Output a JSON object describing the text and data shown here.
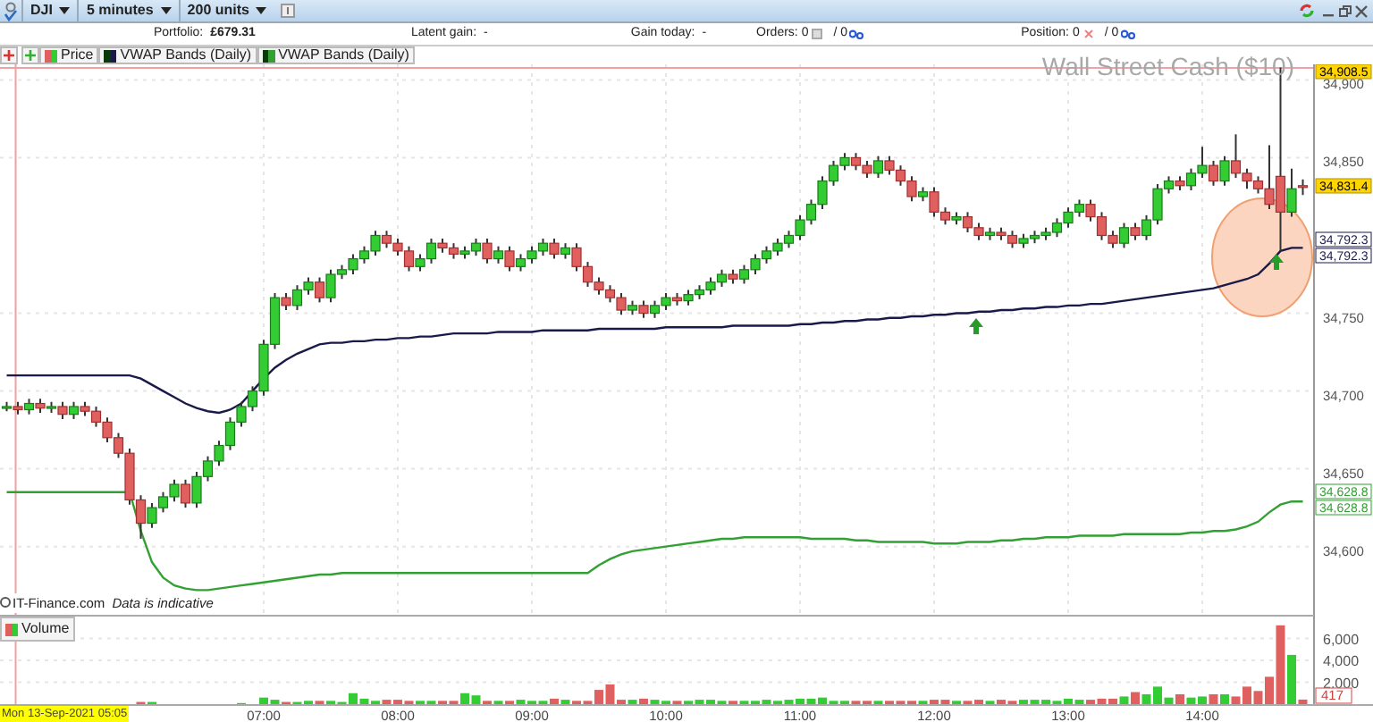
{
  "toolbar": {
    "selectors": [
      {
        "label": "DJI"
      },
      {
        "label": "5 minutes"
      },
      {
        "label": "200 units"
      }
    ]
  },
  "info_bar": {
    "portfolio_label": "Portfolio:",
    "portfolio_value": "£679.31",
    "latent_gain_label": "Latent gain:",
    "latent_gain_value": "-",
    "gain_today_label": "Gain today:",
    "gain_today_value": "-",
    "orders_label": "Orders:",
    "orders_value": "0",
    "orders_active": "/ 0",
    "position_label": "Position:",
    "position_value": "0",
    "position_active": "/ 0"
  },
  "price_legend": {
    "label": "Price"
  },
  "instrument_title": "Wall Street Cash ($10)",
  "source_note": {
    "source": "IT-Finance.com",
    "note": "Data is indicative"
  },
  "price_chart": {
    "chart_data": {
      "type": "candlestick",
      "grid": true,
      "ylim": [
        34555,
        34910
      ],
      "xlim": [
        302,
        916.4
      ],
      "ref_lines": [
        {
          "axis": "x",
          "value": 309,
          "color": "#f0a0a0"
        }
      ],
      "xticks": [
        {
          "value": 420,
          "label": "07:00"
        },
        {
          "value": 480,
          "label": "08:00"
        },
        {
          "value": 540,
          "label": "09:00"
        },
        {
          "value": 600,
          "label": "10:00"
        },
        {
          "value": 660,
          "label": "11:00"
        },
        {
          "value": 720,
          "label": "12:00"
        },
        {
          "value": 780,
          "label": "13:00"
        },
        {
          "value": 840,
          "label": "14:00"
        }
      ],
      "yticks": [
        {
          "value": 34600,
          "label": "34,600"
        },
        {
          "value": 34650,
          "label": "34,650"
        },
        {
          "value": 34700,
          "label": "34,700"
        },
        {
          "value": 34750,
          "label": "34,750"
        },
        {
          "value": 34850,
          "label": "34,850"
        },
        {
          "value": 34900,
          "label": "34,900"
        }
      ],
      "x": [
        305,
        310,
        315,
        320,
        325,
        330,
        335,
        340,
        345,
        350,
        355,
        360,
        365,
        370,
        375,
        380,
        385,
        390,
        395,
        400,
        405,
        410,
        415,
        420,
        425,
        430,
        435,
        440,
        445,
        450,
        455,
        460,
        465,
        470,
        475,
        480,
        485,
        490,
        495,
        500,
        505,
        510,
        515,
        520,
        525,
        530,
        535,
        540,
        545,
        550,
        555,
        560,
        565,
        570,
        575,
        580,
        585,
        590,
        595,
        600,
        605,
        610,
        615,
        620,
        625,
        630,
        635,
        640,
        645,
        650,
        655,
        660,
        665,
        670,
        675,
        680,
        685,
        690,
        695,
        700,
        705,
        710,
        715,
        720,
        725,
        730,
        735,
        740,
        745,
        750,
        755,
        760,
        765,
        770,
        775,
        780,
        785,
        790,
        795,
        800,
        805,
        810,
        815,
        820,
        825,
        830,
        835,
        840,
        845,
        850,
        855,
        860,
        865,
        870,
        875,
        880,
        885
      ],
      "ohlc": [
        [
          34690,
          34693,
          34687,
          34690
        ],
        [
          34690,
          34693,
          34685,
          34688
        ],
        [
          34688,
          34695,
          34685,
          34692
        ],
        [
          34692,
          34695,
          34686,
          34689
        ],
        [
          34689,
          34693,
          34686,
          34690
        ],
        [
          34690,
          34693,
          34682,
          34685
        ],
        [
          34685,
          34693,
          34682,
          34690
        ],
        [
          34690,
          34693,
          34684,
          34687
        ],
        [
          34687,
          34690,
          34677,
          34680
        ],
        [
          34680,
          34683,
          34667,
          34670
        ],
        [
          34670,
          34673,
          34657,
          34660
        ],
        [
          34660,
          34663,
          34627,
          34630
        ],
        [
          34630,
          34633,
          34605,
          34615
        ],
        [
          34615,
          34628,
          34612,
          34625
        ],
        [
          34625,
          34635,
          34622,
          34632
        ],
        [
          34632,
          34643,
          34629,
          34640
        ],
        [
          34640,
          34643,
          34625,
          34628
        ],
        [
          34628,
          34648,
          34625,
          34645
        ],
        [
          34645,
          34658,
          34642,
          34655
        ],
        [
          34655,
          34668,
          34652,
          34665
        ],
        [
          34665,
          34683,
          34662,
          34680
        ],
        [
          34680,
          34693,
          34677,
          34690
        ],
        [
          34690,
          34703,
          34687,
          34700
        ],
        [
          34700,
          34733,
          34697,
          34730
        ],
        [
          34730,
          34763,
          34727,
          34760
        ],
        [
          34760,
          34763,
          34752,
          34755
        ],
        [
          34755,
          34768,
          34752,
          34765
        ],
        [
          34765,
          34773,
          34762,
          34770
        ],
        [
          34770,
          34773,
          34757,
          34760
        ],
        [
          34760,
          34778,
          34757,
          34775
        ],
        [
          34775,
          34781,
          34772,
          34778
        ],
        [
          34778,
          34788,
          34775,
          34785
        ],
        [
          34785,
          34793,
          34782,
          34790
        ],
        [
          34790,
          34803,
          34787,
          34800
        ],
        [
          34800,
          34803,
          34792,
          34795
        ],
        [
          34795,
          34798,
          34787,
          34790
        ],
        [
          34790,
          34793,
          34777,
          34780
        ],
        [
          34780,
          34788,
          34777,
          34785
        ],
        [
          34785,
          34798,
          34782,
          34795
        ],
        [
          34795,
          34798,
          34789,
          34792
        ],
        [
          34792,
          34795,
          34785,
          34788
        ],
        [
          34788,
          34793,
          34785,
          34790
        ],
        [
          34790,
          34798,
          34787,
          34795
        ],
        [
          34795,
          34798,
          34782,
          34785
        ],
        [
          34785,
          34793,
          34782,
          34790
        ],
        [
          34790,
          34793,
          34777,
          34780
        ],
        [
          34780,
          34788,
          34777,
          34785
        ],
        [
          34785,
          34793,
          34782,
          34790
        ],
        [
          34790,
          34798,
          34787,
          34795
        ],
        [
          34795,
          34798,
          34785,
          34788
        ],
        [
          34788,
          34795,
          34785,
          34792
        ],
        [
          34792,
          34795,
          34777,
          34780
        ],
        [
          34780,
          34783,
          34767,
          34770
        ],
        [
          34770,
          34773,
          34762,
          34765
        ],
        [
          34765,
          34768,
          34757,
          34760
        ],
        [
          34760,
          34763,
          34749,
          34752
        ],
        [
          34752,
          34758,
          34749,
          34755
        ],
        [
          34755,
          34758,
          34747,
          34750
        ],
        [
          34750,
          34758,
          34747,
          34755
        ],
        [
          34755,
          34763,
          34752,
          34760
        ],
        [
          34760,
          34763,
          34755,
          34758
        ],
        [
          34758,
          34765,
          34755,
          34762
        ],
        [
          34762,
          34768,
          34759,
          34765
        ],
        [
          34765,
          34773,
          34762,
          34770
        ],
        [
          34770,
          34778,
          34767,
          34775
        ],
        [
          34775,
          34778,
          34769,
          34772
        ],
        [
          34772,
          34781,
          34769,
          34778
        ],
        [
          34778,
          34788,
          34775,
          34785
        ],
        [
          34785,
          34793,
          34782,
          34790
        ],
        [
          34790,
          34798,
          34787,
          34795
        ],
        [
          34795,
          34803,
          34792,
          34800
        ],
        [
          34800,
          34813,
          34797,
          34810
        ],
        [
          34810,
          34823,
          34807,
          34820
        ],
        [
          34820,
          34838,
          34817,
          34835
        ],
        [
          34835,
          34848,
          34832,
          34845
        ],
        [
          34845,
          34853,
          34842,
          34850
        ],
        [
          34850,
          34853,
          34842,
          34845
        ],
        [
          34845,
          34848,
          34837,
          34840
        ],
        [
          34840,
          34851,
          34837,
          34848
        ],
        [
          34848,
          34851,
          34839,
          34842
        ],
        [
          34842,
          34845,
          34832,
          34835
        ],
        [
          34835,
          34838,
          34822,
          34825
        ],
        [
          34825,
          34831,
          34822,
          34828
        ],
        [
          34828,
          34831,
          34812,
          34815
        ],
        [
          34815,
          34818,
          34807,
          34810
        ],
        [
          34810,
          34815,
          34807,
          34812
        ],
        [
          34812,
          34815,
          34802,
          34805
        ],
        [
          34805,
          34808,
          34797,
          34800
        ],
        [
          34800,
          34805,
          34797,
          34802
        ],
        [
          34802,
          34805,
          34797,
          34800
        ],
        [
          34800,
          34803,
          34792,
          34795
        ],
        [
          34795,
          34801,
          34792,
          34798
        ],
        [
          34798,
          34803,
          34795,
          34800
        ],
        [
          34800,
          34805,
          34797,
          34802
        ],
        [
          34802,
          34811,
          34799,
          34808
        ],
        [
          34808,
          34818,
          34805,
          34815
        ],
        [
          34815,
          34823,
          34812,
          34820
        ],
        [
          34820,
          34823,
          34809,
          34812
        ],
        [
          34812,
          34815,
          34797,
          34800
        ],
        [
          34800,
          34803,
          34792,
          34795
        ],
        [
          34795,
          34808,
          34792,
          34805
        ],
        [
          34805,
          34808,
          34797,
          34800
        ],
        [
          34800,
          34813,
          34797,
          34810
        ],
        [
          34810,
          34833,
          34807,
          34830
        ],
        [
          34830,
          34838,
          34827,
          34835
        ],
        [
          34835,
          34838,
          34829,
          34832
        ],
        [
          34832,
          34843,
          34829,
          34840
        ],
        [
          34840,
          34857,
          34837,
          34845
        ],
        [
          34845,
          34848,
          34832,
          34835
        ],
        [
          34835,
          34851,
          34832,
          34848
        ],
        [
          34848,
          34865,
          34837,
          34840
        ],
        [
          34840,
          34843,
          34830,
          34835
        ],
        [
          34835,
          34838,
          34827,
          34830
        ],
        [
          34830,
          34858,
          34817,
          34820
        ],
        [
          34838,
          34908,
          34790,
          34815
        ],
        [
          34815,
          34843,
          34812,
          34830
        ],
        [
          34832,
          34836,
          34826,
          34831
        ]
      ],
      "series": [
        {
          "name": "VWAP Bands (Daily)",
          "type": "line",
          "color": "#1a1a4a",
          "values": [
            34710,
            34710,
            34710,
            34710,
            34710,
            34710,
            34710,
            34710,
            34710,
            34710,
            34710,
            34710,
            34708,
            34704,
            34700,
            34696,
            34692,
            34689,
            34687,
            34686,
            34688,
            34692,
            34700,
            34708,
            34715,
            34720,
            34724,
            34727,
            34730,
            34731,
            34731,
            34732,
            34732,
            34733,
            34733,
            34734,
            34734,
            34735,
            34735,
            34736,
            34737,
            34737,
            34737,
            34737,
            34738,
            34738,
            34738,
            34738,
            34739,
            34739,
            34739,
            34739,
            34739,
            34740,
            34740,
            34740,
            34740,
            34740,
            34740,
            34741,
            34741,
            34741,
            34741,
            34741,
            34741,
            34742,
            34742,
            34742,
            34742,
            34742,
            34742,
            34743,
            34743,
            34744,
            34744,
            34745,
            34745,
            34746,
            34746,
            34747,
            34747,
            34748,
            34748,
            34749,
            34749,
            34750,
            34750,
            34751,
            34751,
            34752,
            34752,
            34753,
            34753,
            34754,
            34754,
            34755,
            34755,
            34756,
            34756,
            34757,
            34758,
            34759,
            34760,
            34761,
            34762,
            34763,
            34764,
            34765,
            34766,
            34768,
            34770,
            34772,
            34775,
            34782,
            34790,
            34792,
            34792
          ]
        },
        {
          "name": "VWAP Bands (Daily)",
          "type": "line",
          "color": "#33a033",
          "values": [
            34635,
            34635,
            34635,
            34635,
            34635,
            34635,
            34635,
            34635,
            34635,
            34635,
            34635,
            34635,
            34610,
            34590,
            34580,
            34575,
            34573,
            34572,
            34572,
            34573,
            34574,
            34575,
            34576,
            34577,
            34578,
            34579,
            34580,
            34581,
            34582,
            34582,
            34583,
            34583,
            34583,
            34583,
            34583,
            34583,
            34583,
            34583,
            34583,
            34583,
            34583,
            34583,
            34583,
            34583,
            34583,
            34583,
            34583,
            34583,
            34583,
            34583,
            34583,
            34583,
            34583,
            34588,
            34592,
            34595,
            34597,
            34598,
            34599,
            34600,
            34601,
            34602,
            34603,
            34604,
            34605,
            34605,
            34606,
            34606,
            34606,
            34606,
            34606,
            34606,
            34605,
            34605,
            34605,
            34605,
            34604,
            34604,
            34603,
            34603,
            34603,
            34603,
            34603,
            34602,
            34602,
            34602,
            34603,
            34603,
            34603,
            34604,
            34604,
            34605,
            34605,
            34606,
            34606,
            34606,
            34607,
            34607,
            34607,
            34607,
            34608,
            34608,
            34608,
            34608,
            34608,
            34608,
            34609,
            34609,
            34610,
            34610,
            34611,
            34613,
            34616,
            34622,
            34627,
            34629,
            34629
          ]
        }
      ]
    }
  },
  "price_markers": [
    {
      "text": "34,908.5",
      "color": "#ffd400"
    },
    {
      "text": "34,831.4",
      "color": "#ffd400"
    },
    {
      "text": "34,792.3",
      "color": "#1a1a4a"
    },
    {
      "text": "34,792.3",
      "color": "#1a1a4a"
    },
    {
      "text": "34,628.8",
      "color": "#33a033"
    },
    {
      "text": "34,628.8",
      "color": "#33a033"
    }
  ],
  "volume_chart": {
    "chart_data": {
      "type": "bar",
      "grid": true,
      "ylim": [
        0,
        8000
      ],
      "yticks": [
        {
          "value": 2000,
          "label": "2,000"
        },
        {
          "value": 4000,
          "label": "4,000"
        },
        {
          "value": 6000,
          "label": "6,000"
        }
      ],
      "series": [
        {
          "name": "Volume",
          "color": "#33cc33",
          "colors": [
            "#33cc33",
            "#e06060",
            "#33cc33",
            "#e06060",
            "#33cc33",
            "#e06060",
            "#33cc33",
            "#e06060",
            "#e06060",
            "#e06060",
            "#e06060",
            "#e06060",
            "#e06060",
            "#33cc33",
            "#33cc33",
            "#33cc33",
            "#e06060",
            "#33cc33",
            "#33cc33",
            "#33cc33",
            "#33cc33",
            "#33cc33",
            "#33cc33",
            "#33cc33",
            "#33cc33",
            "#e06060",
            "#33cc33",
            "#33cc33",
            "#e06060",
            "#33cc33",
            "#33cc33",
            "#33cc33",
            "#33cc33",
            "#33cc33",
            "#e06060",
            "#e06060",
            "#e06060",
            "#33cc33",
            "#33cc33",
            "#e06060",
            "#e06060",
            "#33cc33",
            "#33cc33",
            "#e06060",
            "#33cc33",
            "#e06060",
            "#33cc33",
            "#33cc33",
            "#33cc33",
            "#e06060",
            "#33cc33",
            "#e06060",
            "#e06060",
            "#e06060",
            "#e06060",
            "#e06060",
            "#33cc33",
            "#e06060",
            "#33cc33",
            "#33cc33",
            "#e06060",
            "#33cc33",
            "#33cc33",
            "#33cc33",
            "#33cc33",
            "#e06060",
            "#33cc33",
            "#33cc33",
            "#33cc33",
            "#33cc33",
            "#33cc33",
            "#33cc33",
            "#33cc33",
            "#33cc33",
            "#33cc33",
            "#33cc33",
            "#e06060",
            "#e06060",
            "#33cc33",
            "#e06060",
            "#e06060",
            "#e06060",
            "#33cc33",
            "#e06060",
            "#e06060",
            "#33cc33",
            "#e06060",
            "#e06060",
            "#33cc33",
            "#e06060",
            "#e06060",
            "#33cc33",
            "#33cc33",
            "#33cc33",
            "#33cc33",
            "#33cc33",
            "#33cc33",
            "#e06060",
            "#e06060",
            "#e06060",
            "#33cc33",
            "#e06060",
            "#33cc33",
            "#33cc33",
            "#33cc33",
            "#e06060",
            "#33cc33",
            "#33cc33",
            "#e06060",
            "#33cc33",
            "#e06060",
            "#e06060",
            "#e06060",
            "#e06060",
            "#e06060",
            "#33cc33",
            "#e06060"
          ],
          "values": [
            0,
            0,
            0,
            0,
            0,
            0,
            0,
            0,
            0,
            0,
            0,
            0,
            200,
            200,
            0,
            0,
            0,
            0,
            0,
            0,
            0,
            100,
            0,
            600,
            400,
            200,
            200,
            300,
            300,
            300,
            200,
            1000,
            500,
            300,
            400,
            400,
            300,
            300,
            300,
            300,
            300,
            1000,
            800,
            300,
            300,
            300,
            400,
            300,
            300,
            500,
            400,
            300,
            300,
            1300,
            1800,
            400,
            400,
            500,
            400,
            300,
            300,
            300,
            400,
            400,
            300,
            300,
            300,
            300,
            400,
            300,
            400,
            500,
            500,
            600,
            300,
            300,
            300,
            300,
            300,
            300,
            300,
            300,
            300,
            400,
            400,
            300,
            300,
            400,
            300,
            400,
            300,
            400,
            400,
            400,
            300,
            500,
            400,
            400,
            500,
            500,
            700,
            1100,
            900,
            1600,
            600,
            900,
            600,
            700,
            900,
            900,
            700,
            1600,
            1200,
            2500,
            7200,
            4500,
            417
          ]
        }
      ]
    }
  },
  "volume_marker": "417",
  "crosshair_time": "Mon 13-Sep-2021 05:05"
}
